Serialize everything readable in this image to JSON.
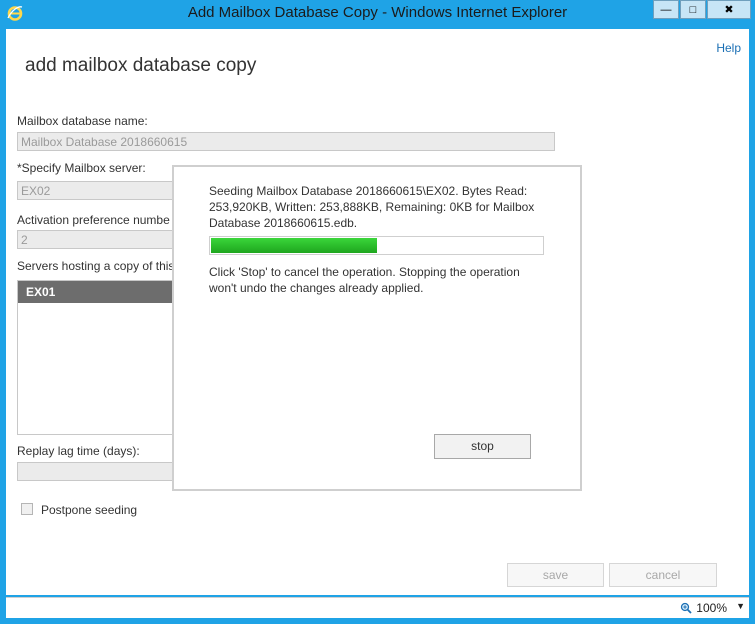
{
  "window": {
    "title": "Add Mailbox Database Copy - Windows Internet Explorer",
    "minimize_glyph": "—",
    "maximize_glyph": "□",
    "close_glyph": "✖",
    "accent_color": "#1fa3e6"
  },
  "page": {
    "help_link": "Help",
    "heading": "add mailbox database copy",
    "db_name_label": "Mailbox database name:",
    "db_name_value": "Mailbox Database 2018660615",
    "server_label": "*Specify Mailbox server:",
    "server_value": "EX02",
    "activation_label": "Activation preference numbe",
    "activation_value": "2",
    "servers_hosting_label": "Servers hosting a copy of this",
    "servers_hosting": [
      "EX01"
    ],
    "replay_lag_label": "Replay lag time (days):",
    "replay_lag_value": "",
    "postpone_label": "Postpone seeding",
    "save_label": "save",
    "cancel_label": "cancel"
  },
  "dialog": {
    "message": "Seeding Mailbox Database 2018660615\\EX02. Bytes Read: 253,920KB, Written: 253,888KB, Remaining: 0KB for Mailbox Database 2018660615.edb.",
    "progress_fraction": 0.5,
    "note": "Click 'Stop' to cancel the operation. Stopping the operation won't undo the changes already applied.",
    "stop_label": "stop"
  },
  "statusbar": {
    "zoom": "100%",
    "zoom_arrow": "▼"
  },
  "icons": {
    "browser_icon": "ie-icon",
    "zoom_icon": "magnifier-icon"
  }
}
